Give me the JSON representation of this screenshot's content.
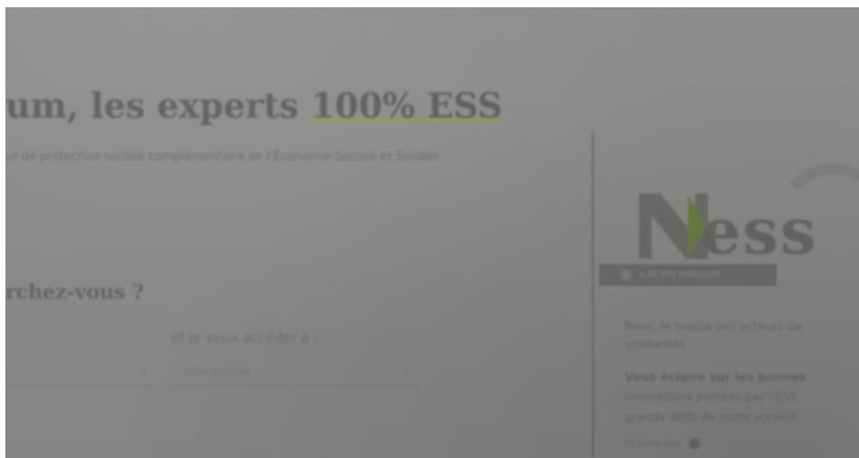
{
  "hero": {
    "title_lead": "um, les experts ",
    "title_accent": "100% ESS",
    "subtitle": "ur de protection sociale complémentaire de l'Économie Sociale et Solidair"
  },
  "search": {
    "heading": "rchez-vous ?",
    "access_label": "et je veux accéder à :",
    "first_select_value": "",
    "second_select_value": "sélectionnez"
  },
  "sidebar": {
    "logo_text": "Ness",
    "pill_label": "À NE PAS MANQUER",
    "intro_line1": "Ness, le média des acteurs de",
    "intro_line2": "solidarités",
    "bold_line1": "Vous éclaire sur les bonnes",
    "bold_line2": "innovations portées par l'ESS",
    "bold_line3": "grands défis de notre société",
    "read_more": "En savoir plus"
  },
  "colors": {
    "overlay": "#8a8a88",
    "accent_underline": "#8a9a55",
    "logo_arrow": "#6e7c45"
  },
  "icons": [
    "chevron-down-icon",
    "chevron-down-icon",
    "info-icon",
    "plus-circle-icon"
  ]
}
